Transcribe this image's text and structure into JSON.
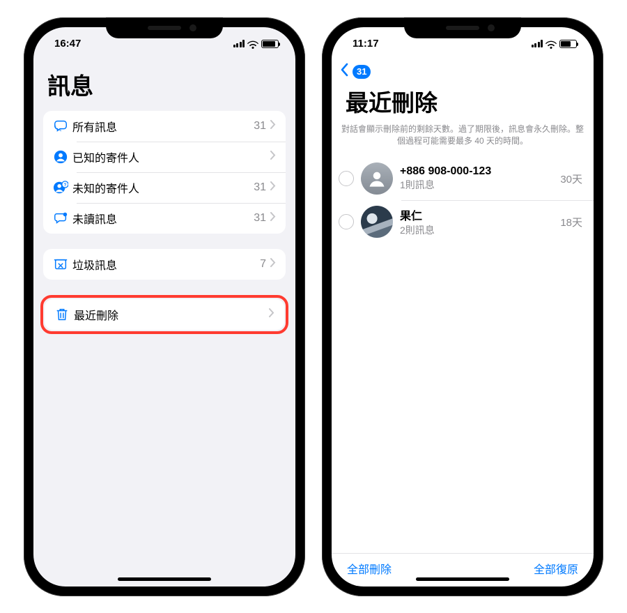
{
  "left": {
    "status_time": "16:47",
    "page_title": "訊息",
    "filters": [
      {
        "icon": "bubbles",
        "label": "所有訊息",
        "count": "31"
      },
      {
        "icon": "person",
        "label": "已知的寄件人",
        "count": ""
      },
      {
        "icon": "person-q",
        "label": "未知的寄件人",
        "count": "31"
      },
      {
        "icon": "bubble-dot",
        "label": "未讀訊息",
        "count": "31"
      }
    ],
    "junk": {
      "icon": "junk",
      "label": "垃圾訊息",
      "count": "7"
    },
    "deleted": {
      "icon": "trash",
      "label": "最近刪除",
      "count": ""
    }
  },
  "right": {
    "status_time": "11:17",
    "back_badge": "31",
    "page_title": "最近刪除",
    "description": "對話會顯示刪除前的剩餘天數。過了期限後，訊息會永久刪除。整個過程可能需要最多 40 天的時間。",
    "items": [
      {
        "name": "+886 908-000-123",
        "sub": "1則訊息",
        "days": "30天",
        "avatar": "placeholder"
      },
      {
        "name": "果仁",
        "sub": "2則訊息",
        "days": "18天",
        "avatar": "photo"
      }
    ],
    "delete_all": "全部刪除",
    "recover_all": "全部復原"
  }
}
